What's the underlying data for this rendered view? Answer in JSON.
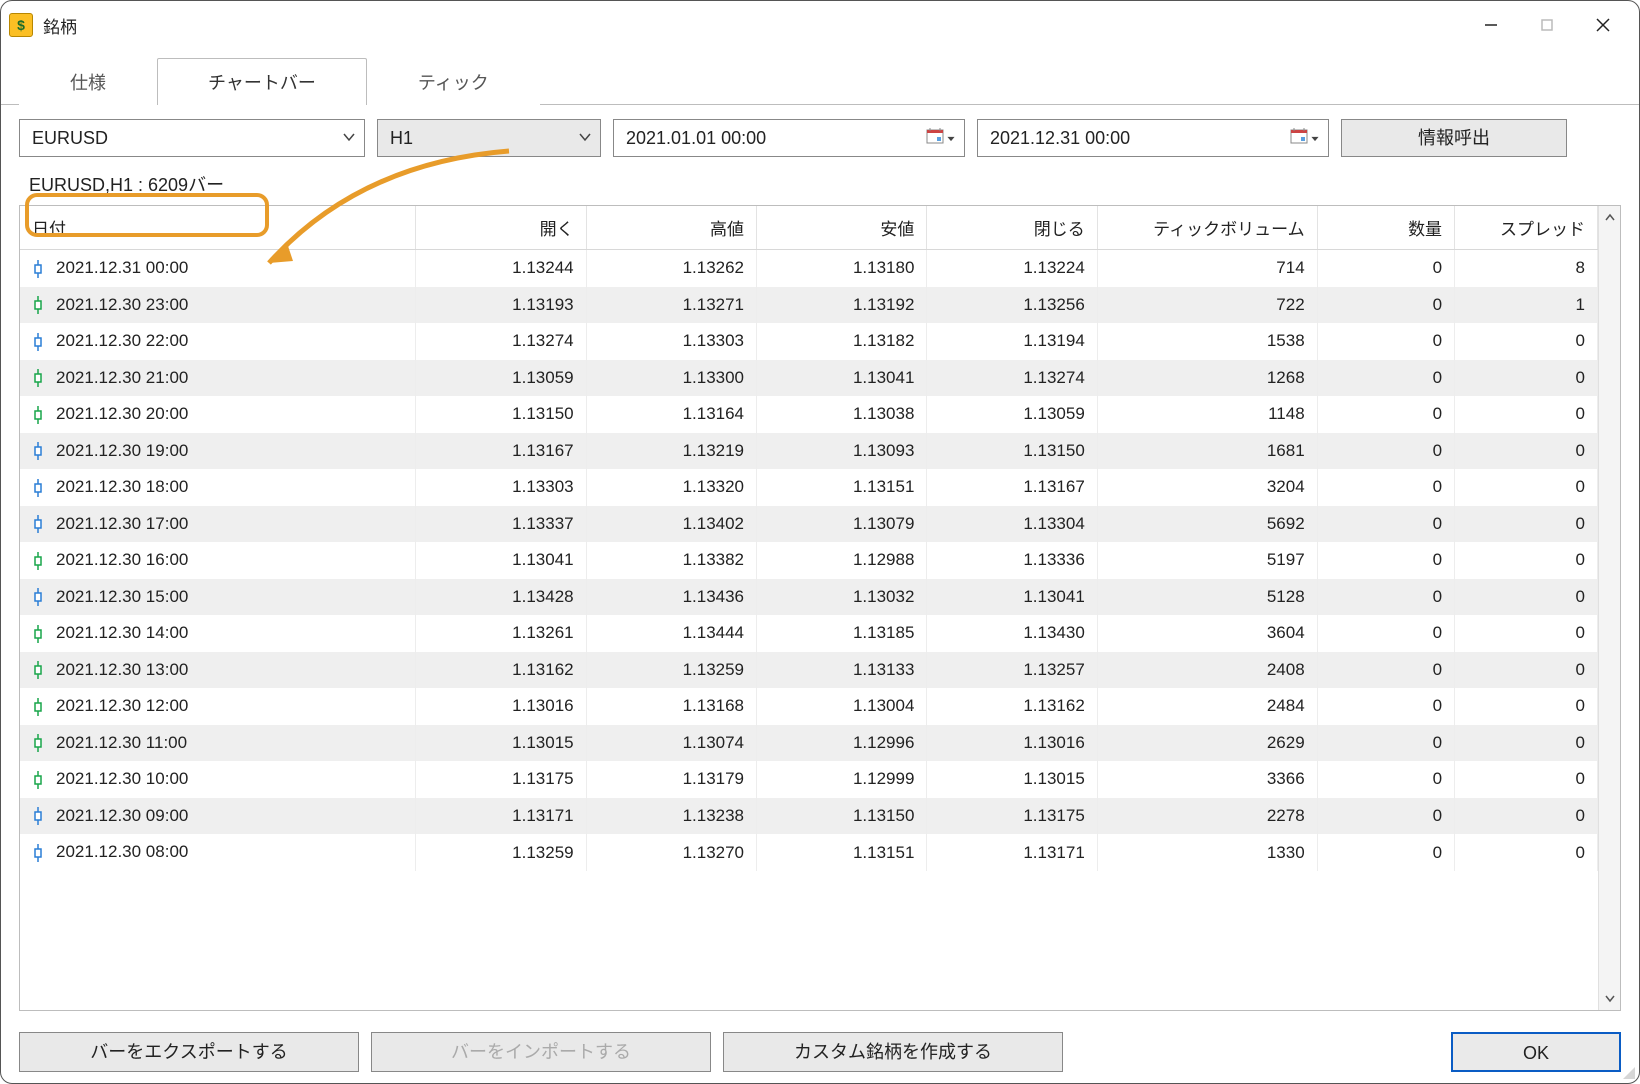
{
  "window": {
    "title": "銘柄"
  },
  "tabs": [
    {
      "label": "仕様",
      "active": false
    },
    {
      "label": "チャートバー",
      "active": true
    },
    {
      "label": "ティック",
      "active": false
    }
  ],
  "filters": {
    "symbol": "EURUSD",
    "timeframe": "H1",
    "from": "2021.01.01 00:00",
    "to": "2021.12.31 00:00",
    "request_btn": "情報呼出"
  },
  "summary": "EURUSD,H1 : 6209バー",
  "columns": {
    "date": "日付",
    "open": "開く",
    "high": "高値",
    "low": "安値",
    "close": "閉じる",
    "tick_volume": "ティックボリューム",
    "volume": "数量",
    "spread": "スプレッド"
  },
  "rows": [
    {
      "dir": "down",
      "date": "2021.12.31 00:00",
      "open": "1.13244",
      "high": "1.13262",
      "low": "1.13180",
      "close": "1.13224",
      "tick": "714",
      "vol": "0",
      "spread": "8"
    },
    {
      "dir": "up",
      "date": "2021.12.30 23:00",
      "open": "1.13193",
      "high": "1.13271",
      "low": "1.13192",
      "close": "1.13256",
      "tick": "722",
      "vol": "0",
      "spread": "1"
    },
    {
      "dir": "down",
      "date": "2021.12.30 22:00",
      "open": "1.13274",
      "high": "1.13303",
      "low": "1.13182",
      "close": "1.13194",
      "tick": "1538",
      "vol": "0",
      "spread": "0"
    },
    {
      "dir": "up",
      "date": "2021.12.30 21:00",
      "open": "1.13059",
      "high": "1.13300",
      "low": "1.13041",
      "close": "1.13274",
      "tick": "1268",
      "vol": "0",
      "spread": "0"
    },
    {
      "dir": "up",
      "date": "2021.12.30 20:00",
      "open": "1.13150",
      "high": "1.13164",
      "low": "1.13038",
      "close": "1.13059",
      "tick": "1148",
      "vol": "0",
      "spread": "0"
    },
    {
      "dir": "down",
      "date": "2021.12.30 19:00",
      "open": "1.13167",
      "high": "1.13219",
      "low": "1.13093",
      "close": "1.13150",
      "tick": "1681",
      "vol": "0",
      "spread": "0"
    },
    {
      "dir": "down",
      "date": "2021.12.30 18:00",
      "open": "1.13303",
      "high": "1.13320",
      "low": "1.13151",
      "close": "1.13167",
      "tick": "3204",
      "vol": "0",
      "spread": "0"
    },
    {
      "dir": "down",
      "date": "2021.12.30 17:00",
      "open": "1.13337",
      "high": "1.13402",
      "low": "1.13079",
      "close": "1.13304",
      "tick": "5692",
      "vol": "0",
      "spread": "0"
    },
    {
      "dir": "up",
      "date": "2021.12.30 16:00",
      "open": "1.13041",
      "high": "1.13382",
      "low": "1.12988",
      "close": "1.13336",
      "tick": "5197",
      "vol": "0",
      "spread": "0"
    },
    {
      "dir": "down",
      "date": "2021.12.30 15:00",
      "open": "1.13428",
      "high": "1.13436",
      "low": "1.13032",
      "close": "1.13041",
      "tick": "5128",
      "vol": "0",
      "spread": "0"
    },
    {
      "dir": "up",
      "date": "2021.12.30 14:00",
      "open": "1.13261",
      "high": "1.13444",
      "low": "1.13185",
      "close": "1.13430",
      "tick": "3604",
      "vol": "0",
      "spread": "0"
    },
    {
      "dir": "up",
      "date": "2021.12.30 13:00",
      "open": "1.13162",
      "high": "1.13259",
      "low": "1.13133",
      "close": "1.13257",
      "tick": "2408",
      "vol": "0",
      "spread": "0"
    },
    {
      "dir": "up",
      "date": "2021.12.30 12:00",
      "open": "1.13016",
      "high": "1.13168",
      "low": "1.13004",
      "close": "1.13162",
      "tick": "2484",
      "vol": "0",
      "spread": "0"
    },
    {
      "dir": "up",
      "date": "2021.12.30 11:00",
      "open": "1.13015",
      "high": "1.13074",
      "low": "1.12996",
      "close": "1.13016",
      "tick": "2629",
      "vol": "0",
      "spread": "0"
    },
    {
      "dir": "up",
      "date": "2021.12.30 10:00",
      "open": "1.13175",
      "high": "1.13179",
      "low": "1.12999",
      "close": "1.13015",
      "tick": "3366",
      "vol": "0",
      "spread": "0"
    },
    {
      "dir": "down",
      "date": "2021.12.30 09:00",
      "open": "1.13171",
      "high": "1.13238",
      "low": "1.13150",
      "close": "1.13175",
      "tick": "2278",
      "vol": "0",
      "spread": "0"
    },
    {
      "dir": "down",
      "date": "2021.12.30 08:00",
      "open": "1.13259",
      "high": "1.13270",
      "low": "1.13151",
      "close": "1.13171",
      "tick": "1330",
      "vol": "0",
      "spread": "0"
    }
  ],
  "footer": {
    "export": "バーをエクスポートする",
    "import": "バーをインポートする",
    "create_custom": "カスタム銘柄を作成する",
    "ok": "OK"
  }
}
